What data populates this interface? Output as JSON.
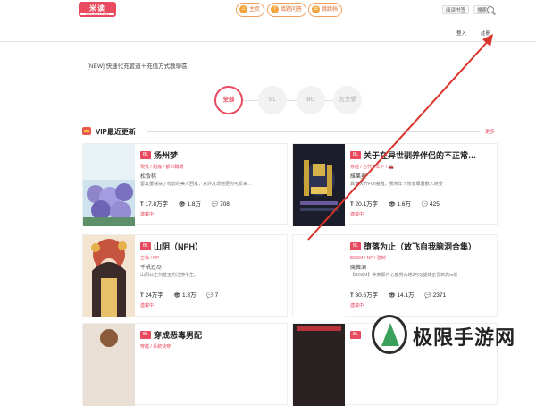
{
  "header": {
    "logo_text": "米读",
    "logo_sub": "MIDUDU.COM",
    "nav": [
      {
        "label": "主页",
        "icon": "home-icon"
      },
      {
        "label": "填题问答",
        "icon": "qa-icon"
      },
      {
        "label": "跳跳档",
        "icon": "archive-icon"
      }
    ],
    "history_label": "阅读书签",
    "search_label": "搜索"
  },
  "auth": {
    "login_label": "登入",
    "register_label": "註冊"
  },
  "notice": "[NEW] 快速代充管道＋充值方式教學區",
  "tabs": [
    {
      "label": "全部",
      "active": true
    },
    {
      "label": "BL",
      "active": false
    },
    {
      "label": "BG",
      "active": false
    },
    {
      "label": "言文學",
      "active": false
    }
  ],
  "section": {
    "title": "VIP最近更新",
    "more_label": "更多"
  },
  "cards": [
    {
      "tag": "BL",
      "title": "扬州梦",
      "genre": "現代 / 甜寵 / 都市職場",
      "author": "松饭桃",
      "desc": "留宾蟹採扶了梳醇的美人回家，意外发现他更为可爱来…",
      "words": "17.8万字",
      "views": "1.8万",
      "comments": "708",
      "status": "連載中"
    },
    {
      "tag": "BL",
      "title": "关于在异世驯养伴侣的不正常…",
      "genre": "穿越 / 古代 / 年下 / 🚗",
      "author": "維果麦",
      "desc": "異世天开Fun養殖，我帶年下修蜜專屬獸人族受",
      "words": "20.1万字",
      "views": "1.6万",
      "comments": "425",
      "status": "連載中"
    },
    {
      "tag": "BL",
      "title": "山阴（NPH）",
      "genre": "古代 / NP",
      "author": "千帆过尽",
      "desc": "山阴公主刘楚玉的注撩半生。",
      "words": "24万字",
      "views": "1.3万",
      "comments": "7",
      "status": "連載中"
    },
    {
      "tag": "BL",
      "title": "堕落为止（放飞自我脑洞合集）",
      "genre": "BDSM / NP / 強制",
      "author": "魔薇酒",
      "desc": "【BDSM】养表邪内心魔男大佬3与Q腿体正喜新高m受",
      "words": "30.6万字",
      "views": "14.1万",
      "comments": "2371",
      "status": "連載中"
    },
    {
      "tag": "BL",
      "title": "穿成恶毒男配",
      "genre": "穿越 / 系統快穿",
      "author": "",
      "desc": "",
      "words": "",
      "views": "",
      "comments": "",
      "status": ""
    },
    {
      "tag": "BL",
      "title": "",
      "genre": "",
      "author": "",
      "desc": "",
      "words": "",
      "views": "",
      "comments": "",
      "status": ""
    }
  ],
  "watermark": {
    "text": "极限手游网",
    "icon": "watermark-logo-icon"
  },
  "colors": {
    "accent": "#e84a5f",
    "nav_border": "#f0a060",
    "arrow": "#d9342b"
  }
}
